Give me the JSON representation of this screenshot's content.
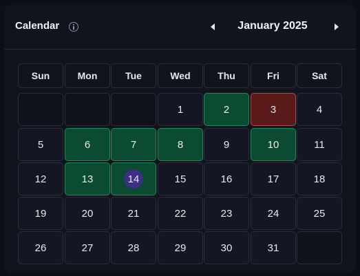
{
  "header": {
    "title": "Calendar",
    "month_label": "January 2025"
  },
  "weekdays": [
    "Sun",
    "Mon",
    "Tue",
    "Wed",
    "Thu",
    "Fri",
    "Sat"
  ],
  "weeks": [
    [
      {
        "d": ""
      },
      {
        "d": ""
      },
      {
        "d": ""
      },
      {
        "d": "1"
      },
      {
        "d": "2",
        "s": "green"
      },
      {
        "d": "3",
        "s": "red"
      },
      {
        "d": "4"
      }
    ],
    [
      {
        "d": "5"
      },
      {
        "d": "6",
        "s": "green"
      },
      {
        "d": "7",
        "s": "green"
      },
      {
        "d": "8",
        "s": "green"
      },
      {
        "d": "9"
      },
      {
        "d": "10",
        "s": "green"
      },
      {
        "d": "11"
      }
    ],
    [
      {
        "d": "12"
      },
      {
        "d": "13",
        "s": "green"
      },
      {
        "d": "14",
        "s": "green",
        "today": true
      },
      {
        "d": "15"
      },
      {
        "d": "16"
      },
      {
        "d": "17"
      },
      {
        "d": "18"
      }
    ],
    [
      {
        "d": "19"
      },
      {
        "d": "20"
      },
      {
        "d": "21"
      },
      {
        "d": "22"
      },
      {
        "d": "23"
      },
      {
        "d": "24"
      },
      {
        "d": "25"
      }
    ],
    [
      {
        "d": "26"
      },
      {
        "d": "27"
      },
      {
        "d": "28"
      },
      {
        "d": "29"
      },
      {
        "d": "30"
      },
      {
        "d": "31"
      },
      {
        "d": ""
      }
    ]
  ],
  "colors": {
    "green_day": "#0a4b32",
    "red_day": "#5a1a1a",
    "today_marker": "#3b2f86"
  }
}
